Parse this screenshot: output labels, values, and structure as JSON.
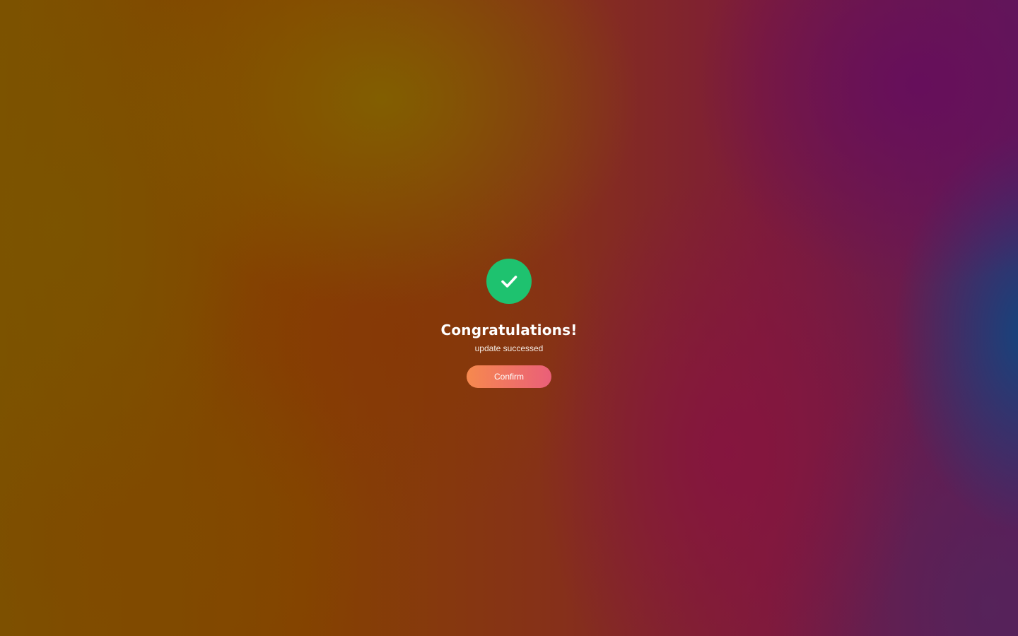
{
  "colors": {
    "success": "#1ec26f",
    "button_start": "#f6894e",
    "button_end": "#ea5f79",
    "text": "#ffffff"
  },
  "dialog": {
    "icon": "check-circle-icon",
    "title": "Congratulations!",
    "message": "update successed",
    "confirm_label": "Confirm"
  }
}
